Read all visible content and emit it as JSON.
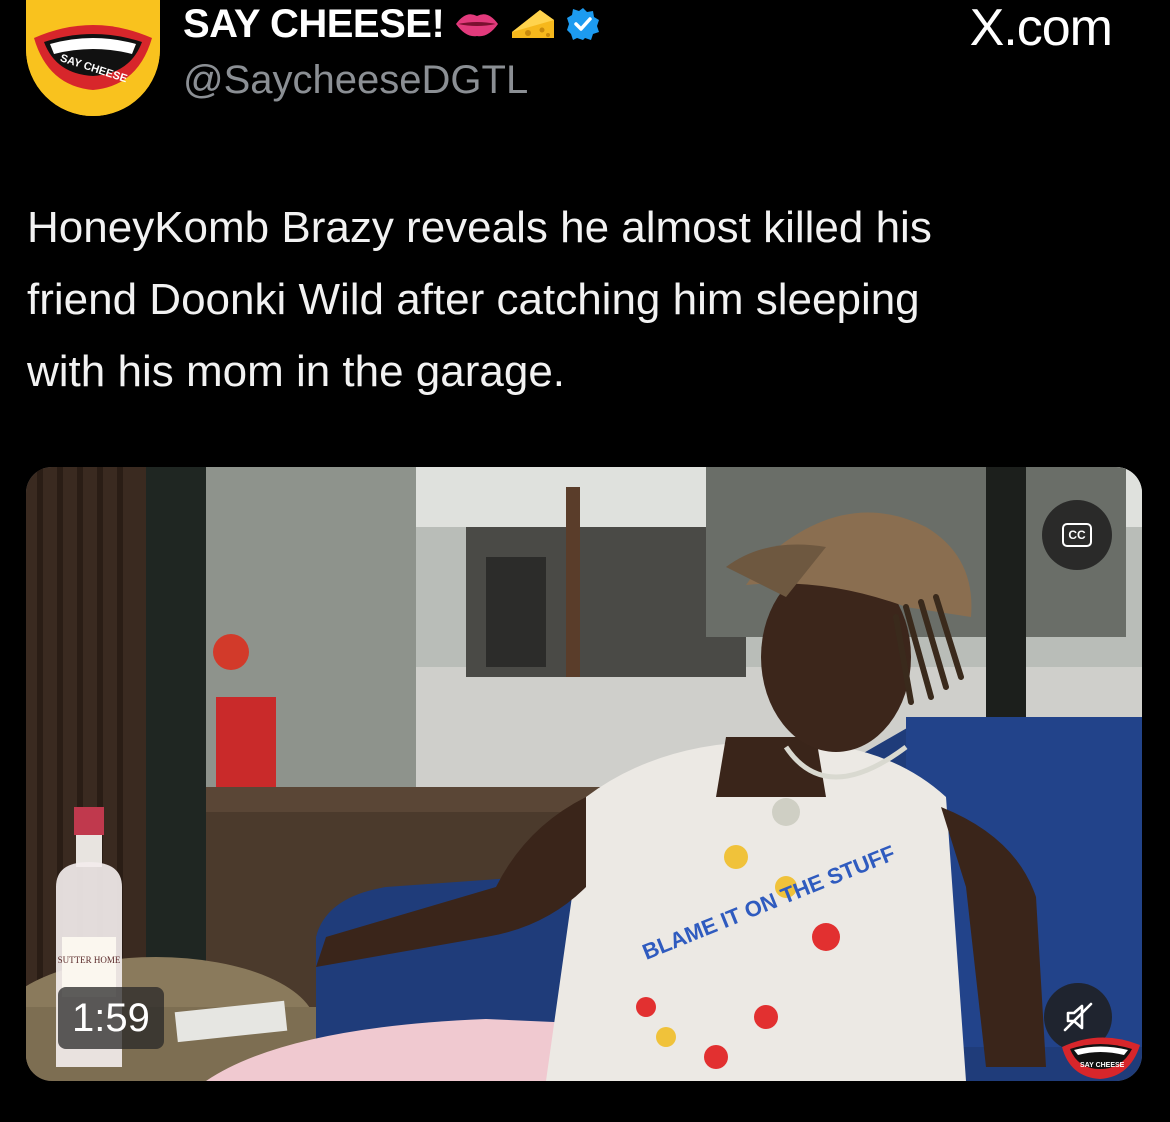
{
  "author": {
    "display_name": "SAY CHEESE!",
    "handle": "@SaycheeseDGTL",
    "avatar_text": "SAY CHEESE",
    "emojis": [
      "lips-emoji",
      "cheese-emoji"
    ],
    "verified": true
  },
  "site": "X.com",
  "tweet": {
    "text": "HoneyKomb Brazy reveals he almost killed his\nfriend Doonki Wild after catching him sleeping\nwith his mom in the garage."
  },
  "video": {
    "duration": "1:59",
    "captions_label": "CC",
    "muted": true,
    "bottle_label": "SUTTER HOME",
    "shirt_text": "BLAME IT ON THE STUFF",
    "watermark_text": "SAY CHEESE"
  },
  "colors": {
    "background": "#000000",
    "text": "#ffffff",
    "handle": "#8b8f94",
    "verified": "#1d9bf0",
    "avatar_bg": "#f9c21e",
    "lips": "#d7262b"
  }
}
